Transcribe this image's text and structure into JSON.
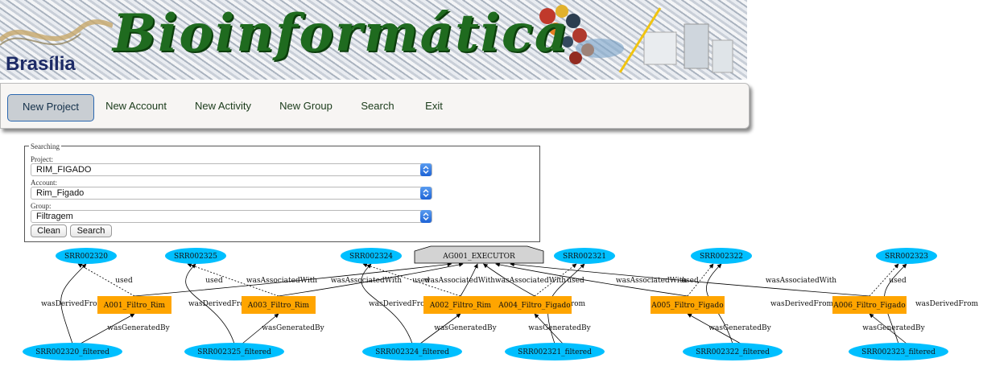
{
  "banner": {
    "title": "Bioinformática",
    "city": "Brasília"
  },
  "nav": [
    {
      "label": "New Project",
      "active": true
    },
    {
      "label": "New Account"
    },
    {
      "label": "New Activity"
    },
    {
      "label": "New Group"
    },
    {
      "label": "Search"
    },
    {
      "label": "Exit"
    }
  ],
  "search": {
    "legend": "Searching",
    "project_label": "Project:",
    "project_value": "RIM_FIGADO",
    "account_label": "Account:",
    "account_value": "Rim_Figado",
    "group_label": "Group:",
    "group_value": "Filtragem",
    "clean_label": "Clean",
    "search_label": "Search"
  },
  "graph": {
    "agent": "AG001_EXECUTOR",
    "entities_top": [
      "SRR002320",
      "SRR002325",
      "SRR002324",
      "SRR002321",
      "SRR002322",
      "SRR002323"
    ],
    "activities": [
      "A001_Filtro_Rim",
      "A003_Filtro_Rim",
      "A002_Filtro_Rim",
      "A004_Filtro_Figado",
      "A005_Filtro_Figado",
      "A006_Filtro_Figado"
    ],
    "entities_bottom": [
      "SRR002320_filtered",
      "SRR002325_filtered",
      "SRR002324_filtered",
      "SRR002321_filtered",
      "SRR002322_filtered",
      "SRR002323_filtered"
    ],
    "edge_labels": {
      "used": "used",
      "derived": "wasDerivedFrom",
      "generated": "wasGeneratedBy",
      "associated": "wasAssociatedWith"
    },
    "colors": {
      "entity": "#00bfff",
      "activity": "#ffa500",
      "agent": "#d3d3d3"
    }
  }
}
